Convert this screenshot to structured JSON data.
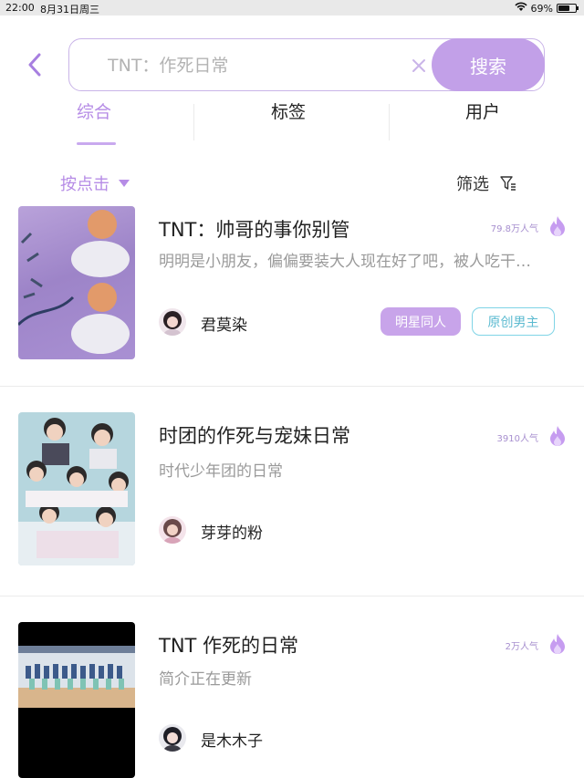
{
  "status_bar": {
    "time": "22:00",
    "date": "8月31日周三",
    "battery_text": "69%",
    "battery_level": 0.69
  },
  "search": {
    "placeholder": "TNT：作死日常",
    "button_label": "搜索"
  },
  "tabs": [
    {
      "label": "综合",
      "active": true
    },
    {
      "label": "标签",
      "active": false
    },
    {
      "label": "用户",
      "active": false
    }
  ],
  "sort": {
    "label": "按点击"
  },
  "filter": {
    "label": "筛选"
  },
  "results": [
    {
      "title": "TNT：帅哥的事你别管",
      "description": "明明是小朋友，偏偏要装大人现在好了吧，被人吃干…",
      "popularity": "79.8万人气",
      "author": "君莫染",
      "tags": [
        "明星同人",
        "原创男主"
      ]
    },
    {
      "title": "时团的作死与宠妹日常",
      "description": "时代少年团的日常",
      "popularity": "3910人气",
      "author": "芽芽的粉",
      "tags": []
    },
    {
      "title": "TNT 作死的日常",
      "description": "简介正在更新",
      "popularity": "2万人气",
      "author": "是木木子",
      "tags": []
    }
  ],
  "colors": {
    "accent": "#c2a0e8",
    "accent_text": "#b68ce6",
    "tag_cyan": "#7fd4e6",
    "fire": "#c69cf0"
  }
}
